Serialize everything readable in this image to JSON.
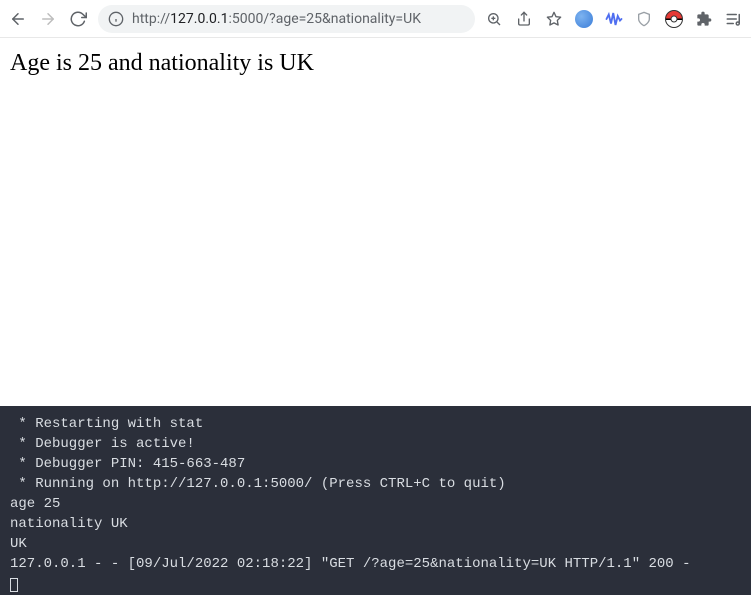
{
  "toolbar": {
    "url_host": "127.0.0.1",
    "url_port": ":5000",
    "url_path": "/?age=25&nationality=UK",
    "url_scheme": "http://"
  },
  "page": {
    "body_text": "Age is 25 and nationality is UK"
  },
  "terminal": {
    "lines": [
      " * Restarting with stat",
      " * Debugger is active!",
      " * Debugger PIN: 415-663-487",
      " * Running on http://127.0.0.1:5000/ (Press CTRL+C to quit)",
      "age 25",
      "nationality UK",
      "UK",
      "127.0.0.1 - - [09/Jul/2022 02:18:22] \"GET /?age=25&nationality=UK HTTP/1.1\" 200 -"
    ]
  }
}
